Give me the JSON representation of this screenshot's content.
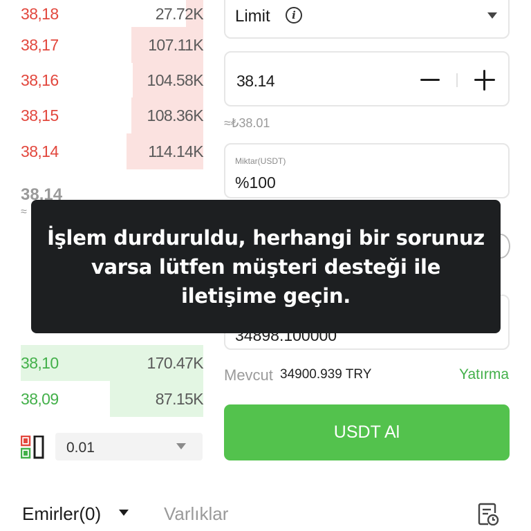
{
  "order_book": {
    "asks": [
      {
        "price": "38,18",
        "qty": "27.72K",
        "depth": 0.15
      },
      {
        "price": "38,17",
        "qty": "107.11K",
        "depth": 0.63
      },
      {
        "price": "38,16",
        "qty": "104.58K",
        "depth": 0.62
      },
      {
        "price": "38,15",
        "qty": "108.36K",
        "depth": 0.63
      },
      {
        "price": "38,14",
        "qty": "114.14K",
        "depth": 0.67
      }
    ],
    "mid_price": "38.14",
    "mid_approx": "≈",
    "bids": [
      {
        "price": "38,10",
        "qty": "170.47K",
        "depth": 1.0
      },
      {
        "price": "38,09",
        "qty": "87.15K",
        "depth": 0.51
      }
    ],
    "depth_select": {
      "value": "0.01"
    }
  },
  "order_form": {
    "order_type": "Limit",
    "price_value": "38.14",
    "approx_price": "≈₺38.01",
    "amount_label": "Miktar(USDT)",
    "amount_value": "%100",
    "total_value": "34898.100000",
    "available_label": "Mevcut",
    "available_value": "34900.939 TRY",
    "deposit_label": "Yatırma",
    "buy_button": "USDT Al"
  },
  "bottom_tabs": {
    "orders": "Emirler(0)",
    "assets": "Varlıklar"
  },
  "toast": {
    "message": "İşlem durduruldu, herhangi bir sorunuz varsa lütfen müşteri desteği ile iletişime geçin."
  },
  "colors": {
    "ask_red": "#e2473d",
    "bid_green": "#43b04a",
    "buy_green": "#53c24d",
    "toast_bg": "#1d1f21"
  }
}
